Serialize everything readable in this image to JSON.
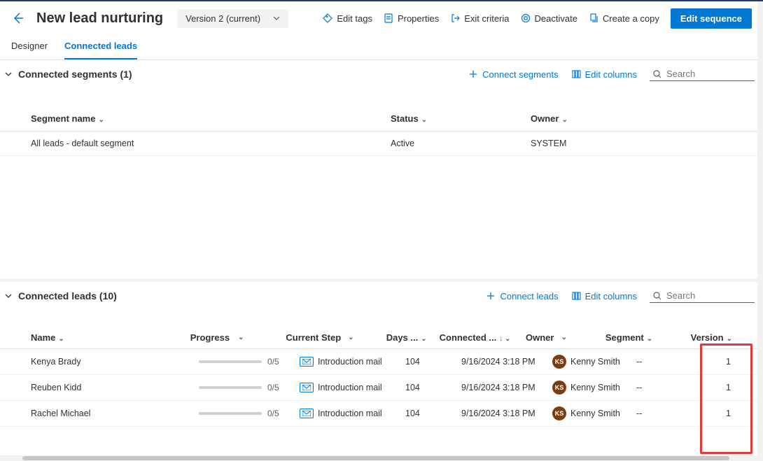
{
  "page_title": "New lead nurturing",
  "version_label": "Version 2 (current)",
  "top_actions": {
    "edit_tags": "Edit tags",
    "properties": "Properties",
    "exit_criteria": "Exit criteria",
    "deactivate": "Deactivate",
    "create_copy": "Create a copy",
    "edit_sequence": "Edit sequence"
  },
  "tabs": {
    "designer": "Designer",
    "connected_leads": "Connected leads"
  },
  "segments": {
    "title": "Connected segments (1)",
    "actions": {
      "connect": "Connect segments",
      "edit_columns": "Edit columns",
      "search_placeholder": "Search"
    },
    "columns": {
      "name": "Segment name",
      "status": "Status",
      "owner": "Owner"
    },
    "rows": [
      {
        "name": "All leads - default segment",
        "status": "Active",
        "owner": "SYSTEM"
      }
    ]
  },
  "leads": {
    "title": "Connected leads (10)",
    "actions": {
      "connect": "Connect leads",
      "edit_columns": "Edit columns",
      "search_placeholder": "Search"
    },
    "columns": {
      "name": "Name",
      "progress": "Progress",
      "current_step": "Current Step",
      "days": "Days ...",
      "connected": "Connected ...",
      "owner": "Owner",
      "segment": "Segment",
      "version": "Version"
    },
    "rows": [
      {
        "name": "Kenya Brady",
        "progress": "0/5",
        "step": "Introduction mail",
        "days": "104",
        "connected": "9/16/2024 3:18 PM",
        "owner_initials": "KS",
        "owner": "Kenny Smith",
        "segment": "--",
        "version": "1"
      },
      {
        "name": "Reuben Kidd",
        "progress": "0/5",
        "step": "Introduction mail",
        "days": "104",
        "connected": "9/16/2024 3:18 PM",
        "owner_initials": "KS",
        "owner": "Kenny Smith",
        "segment": "--",
        "version": "1"
      },
      {
        "name": "Rachel Michael",
        "progress": "0/5",
        "step": "Introduction mail",
        "days": "104",
        "connected": "9/16/2024 3:18 PM",
        "owner_initials": "KS",
        "owner": "Kenny Smith",
        "segment": "--",
        "version": "1"
      }
    ]
  }
}
